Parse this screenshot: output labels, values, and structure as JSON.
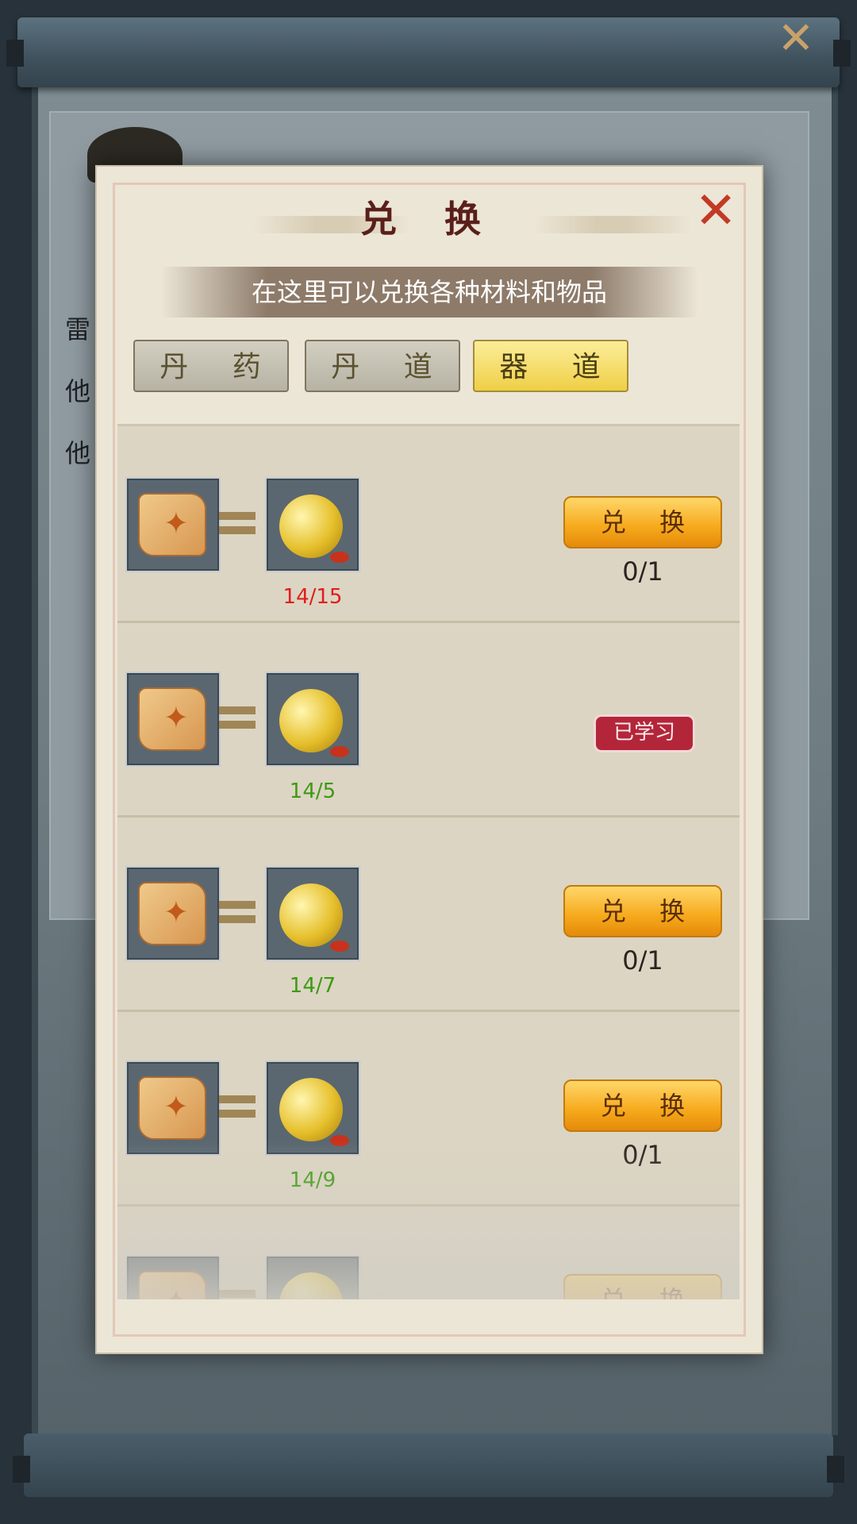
{
  "background": {
    "lines": [
      "雷",
      "他",
      "他"
    ]
  },
  "dialog": {
    "title": "兑 换",
    "subtitle": "在这里可以兑换各种材料和物品",
    "tabs": [
      "丹 药",
      "丹 道",
      "器 道"
    ],
    "active_tab": "器 道",
    "items": [
      {
        "count": "14/15",
        "count_color": "#e21d1d",
        "state": "exchange",
        "button": "兑 换",
        "limit": "0/1"
      },
      {
        "count": "14/5",
        "count_color": "#3d9a12",
        "state": "learned",
        "badge": "已学习"
      },
      {
        "count": "14/7",
        "count_color": "#3d9a12",
        "state": "exchange",
        "button": "兑 换",
        "limit": "0/1"
      },
      {
        "count": "14/9",
        "count_color": "#3d9a12",
        "state": "exchange",
        "button": "兑 换",
        "limit": "0/1"
      },
      {
        "count": "",
        "state": "exchange",
        "button": "兑 换",
        "limit": ""
      }
    ]
  },
  "icons": {
    "close": "close-icon",
    "recipe": "recipe-scroll-icon",
    "currency": "jade-coin-icon"
  },
  "colors": {
    "insufficient": "#e21d1d",
    "sufficient": "#3d9a12",
    "active_tab": "#f0cf46",
    "exchange_button": "#f6a91b",
    "learned_badge": "#b3263a"
  }
}
